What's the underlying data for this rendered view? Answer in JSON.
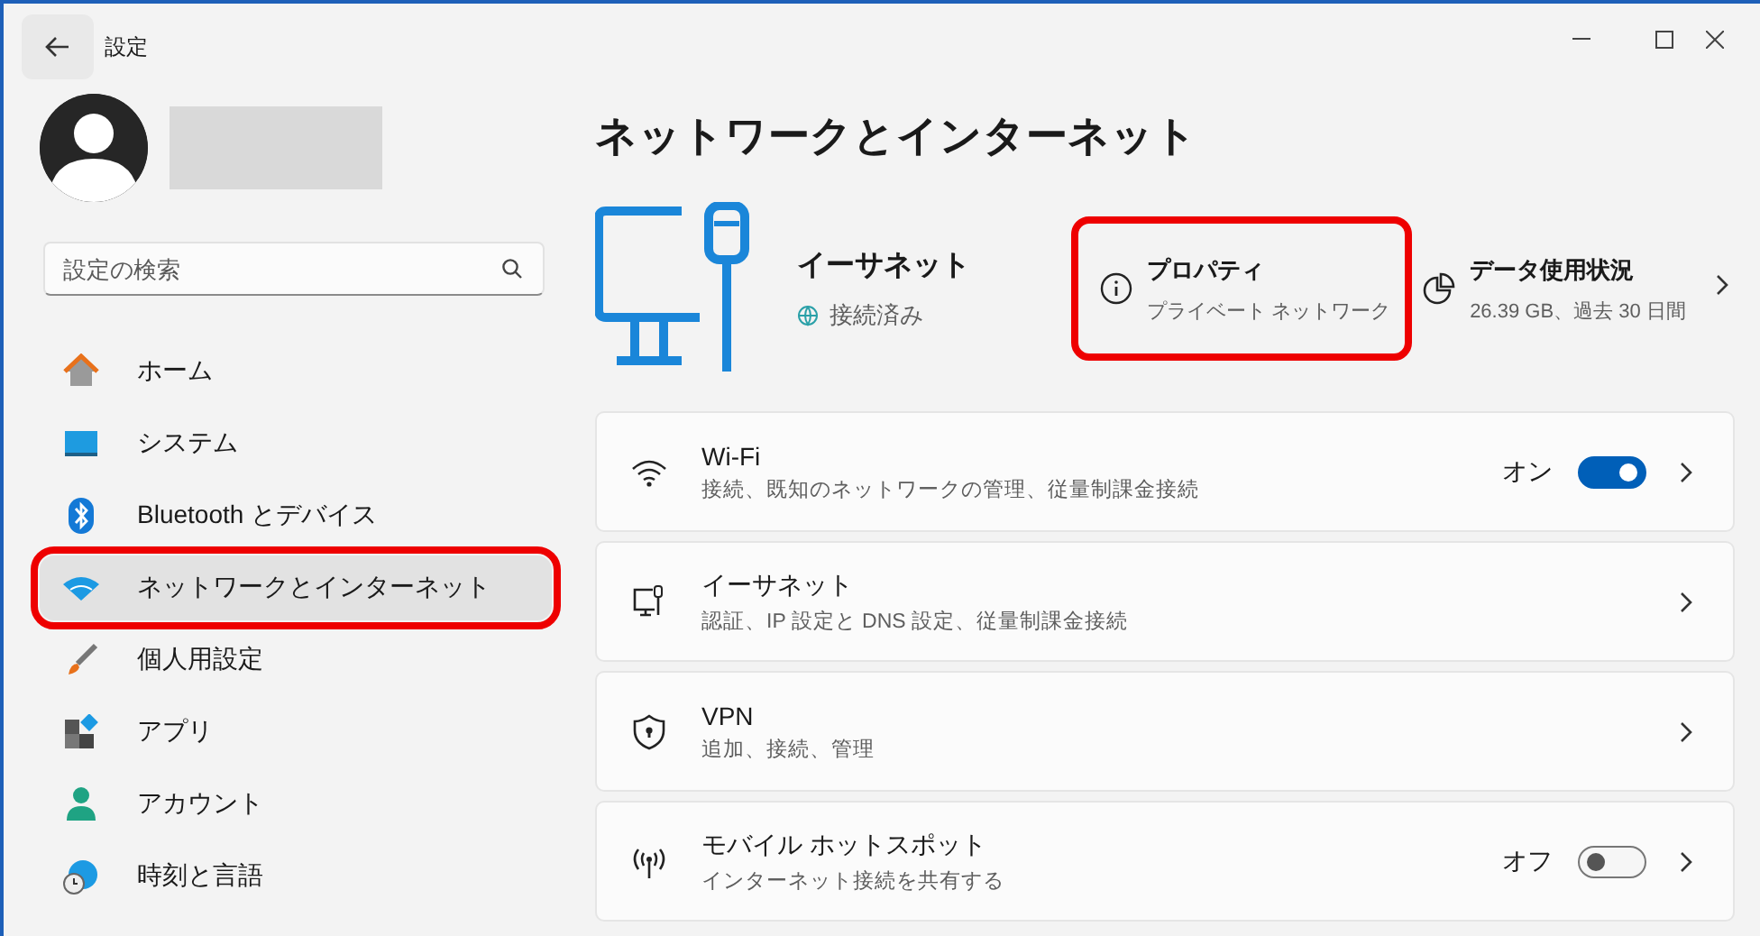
{
  "window": {
    "title": "設定"
  },
  "search": {
    "placeholder": "設定の検索"
  },
  "nav_items": [
    {
      "label": "ホーム",
      "selected": false,
      "highlighted": false
    },
    {
      "label": "システム",
      "selected": false,
      "highlighted": false
    },
    {
      "label": "Bluetooth とデバイス",
      "selected": false,
      "highlighted": false
    },
    {
      "label": "ネットワークとインターネット",
      "selected": true,
      "highlighted": true
    },
    {
      "label": "個人用設定",
      "selected": false,
      "highlighted": false
    },
    {
      "label": "アプリ",
      "selected": false,
      "highlighted": false
    },
    {
      "label": "アカウント",
      "selected": false,
      "highlighted": false
    },
    {
      "label": "時刻と言語",
      "selected": false,
      "highlighted": false
    }
  ],
  "page_title": "ネットワークとインターネット",
  "connection": {
    "name": "イーサネット",
    "status": "接続済み"
  },
  "properties": {
    "title": "プロパティ",
    "subtitle": "プライベート ネットワーク",
    "highlighted": true
  },
  "data_usage": {
    "title": "データ使用状況",
    "subtitle": "26.39 GB、過去 30 日間"
  },
  "cards": [
    {
      "kind": "toggle",
      "title": "Wi-Fi",
      "subtitle": "接続、既知のネットワークの管理、従量制課金接続",
      "state_label": "オン",
      "on": true
    },
    {
      "kind": "link",
      "title": "イーサネット",
      "subtitle": "認証、IP 設定と DNS 設定、従量制課金接続"
    },
    {
      "kind": "link",
      "title": "VPN",
      "subtitle": "追加、接続、管理"
    },
    {
      "kind": "toggle",
      "title": "モバイル ホットスポット",
      "subtitle": "インターネット接続を共有する",
      "state_label": "オフ",
      "on": false
    }
  ]
}
